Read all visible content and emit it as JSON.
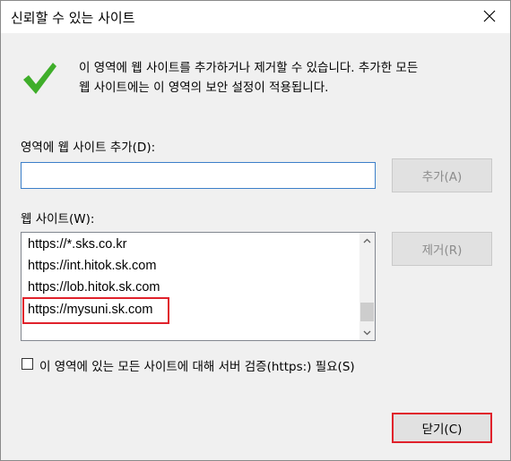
{
  "window": {
    "title": "신뢰할 수 있는 사이트"
  },
  "info": {
    "line1": "이 영역에 웹 사이트를 추가하거나 제거할 수 있습니다. 추가한 모든",
    "line2": "웹 사이트에는 이 영역의 보안 설정이 적용됩니다."
  },
  "add_site": {
    "label": "영역에 웹 사이트 추가(D):",
    "value": "",
    "add_button": "추가(A)"
  },
  "websites": {
    "label": "웹 사이트(W):",
    "items": [
      "https://*.sks.co.kr",
      "https://int.hitok.sk.com",
      "https://lob.hitok.sk.com",
      "https://mysuni.sk.com"
    ],
    "remove_button": "제거(R)"
  },
  "https_check": {
    "label": "이 영역에 있는 모든 사이트에 대해 서버 검증(https:) 필요(S)",
    "checked": false
  },
  "footer": {
    "close_button": "닫기(C)"
  },
  "colors": {
    "highlight": "#e0212b",
    "check": "#3fae2a",
    "input_border": "#3c7fc9"
  }
}
